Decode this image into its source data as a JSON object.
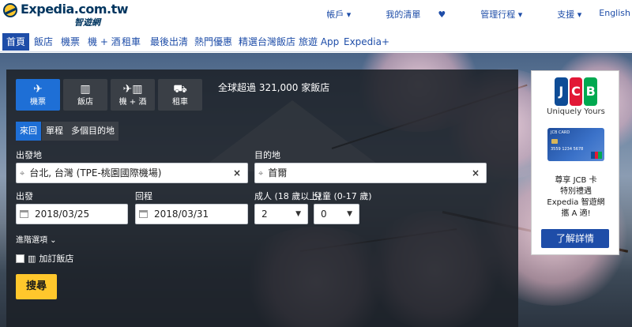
{
  "header": {
    "logo_text": "Expedia.com.tw",
    "logo_sub": "智遊網",
    "links": [
      {
        "label": "帳戶"
      },
      {
        "label": "我的清單",
        "heart": "♥"
      },
      {
        "label": "管理行程"
      },
      {
        "label": "支援"
      },
      {
        "label": "English"
      }
    ]
  },
  "nav": {
    "items": [
      {
        "label": "首頁",
        "active": true
      },
      {
        "label": "飯店"
      },
      {
        "label": "機票"
      },
      {
        "label": "機 + 酒"
      },
      {
        "label": "租車"
      },
      {
        "label": "最後出清"
      },
      {
        "label": "熱門優惠"
      },
      {
        "label": "精選台灣飯店"
      },
      {
        "label": "旅遊 App"
      },
      {
        "label": "Expedia+"
      }
    ]
  },
  "search": {
    "tabs": [
      {
        "label": "機票",
        "icon": "plane-icon",
        "active": true
      },
      {
        "label": "飯店",
        "icon": "building-icon"
      },
      {
        "label": "機 + 酒",
        "icon": "plane-building-icon"
      },
      {
        "label": "租車",
        "icon": "car-icon"
      }
    ],
    "tagline": "全球超過 321,000 家飯店",
    "trip_types": [
      {
        "label": "來回",
        "active": true
      },
      {
        "label": "單程"
      },
      {
        "label": "多個目的地"
      }
    ],
    "origin_label": "出發地",
    "origin_value": "台北, 台灣 (TPE-桃園國際機場)",
    "destination_label": "目的地",
    "destination_value": "首爾",
    "depart_label": "出發",
    "depart_value": "2018/03/25",
    "return_label": "回程",
    "return_value": "2018/03/31",
    "adults_label": "成人 (18 歲以上)",
    "adults_value": "2",
    "children_label": "兒童 (0-17 歲)",
    "children_value": "0",
    "advanced_label": "進階選項",
    "add_hotel_label": "加訂飯店",
    "search_button": "搜尋"
  },
  "ad": {
    "jcb_letters": [
      "J",
      "C",
      "B"
    ],
    "tagline": "Uniquely Yours",
    "card_title": "JCB CARD",
    "card_number": "3559 1234 5678",
    "text": "尊享 JCB 卡\n特別禮遇\nExpedia 智遊網\n攜 A 適!",
    "button": "了解詳情"
  },
  "colors": {
    "brand_navy": "#00355f",
    "link_blue": "#1e4da8",
    "active_tab": "#1e6fd6",
    "search_yellow": "#ffc72c",
    "heart_red": "#e0262c"
  }
}
